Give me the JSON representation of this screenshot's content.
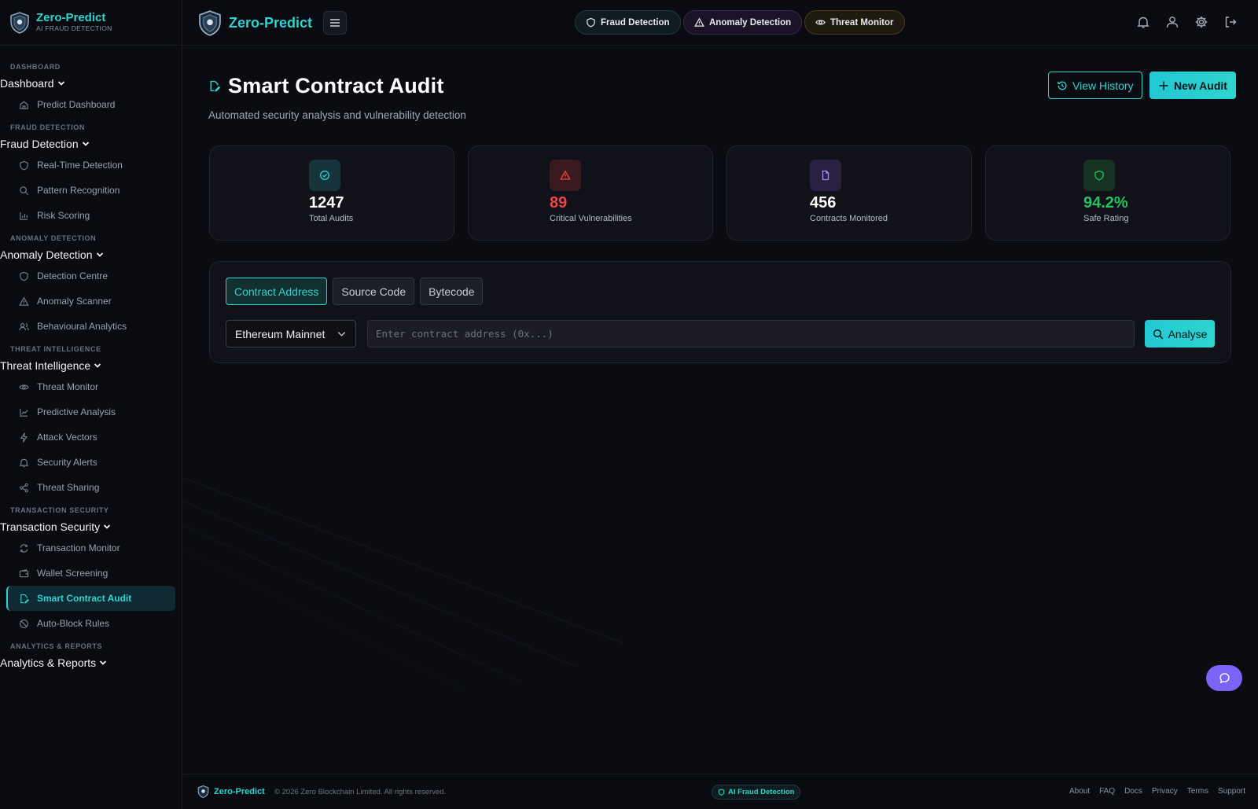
{
  "brand": {
    "name": "Zero-Predict",
    "tagline": "AI FRAUD DETECTION"
  },
  "sidebar": {
    "sections": [
      {
        "label": "DASHBOARD",
        "group": "Dashboard",
        "items": [
          {
            "label": "Predict Dashboard",
            "icon": "home-icon"
          }
        ]
      },
      {
        "label": "FRAUD DETECTION",
        "group": "Fraud Detection",
        "items": [
          {
            "label": "Real-Time Detection",
            "icon": "shield-icon"
          },
          {
            "label": "Pattern Recognition",
            "icon": "search-icon"
          },
          {
            "label": "Risk Scoring",
            "icon": "bar-chart-icon"
          }
        ]
      },
      {
        "label": "ANOMALY DETECTION",
        "group": "Anomaly Detection",
        "items": [
          {
            "label": "Detection Centre",
            "icon": "shield-icon"
          },
          {
            "label": "Anomaly Scanner",
            "icon": "warning-icon"
          },
          {
            "label": "Behavioural Analytics",
            "icon": "users-icon"
          }
        ]
      },
      {
        "label": "THREAT INTELLIGENCE",
        "group": "Threat Intelligence",
        "items": [
          {
            "label": "Threat Monitor",
            "icon": "eye-icon"
          },
          {
            "label": "Predictive Analysis",
            "icon": "line-chart-icon"
          },
          {
            "label": "Attack Vectors",
            "icon": "lightning-icon"
          },
          {
            "label": "Security Alerts",
            "icon": "bell-icon"
          },
          {
            "label": "Threat Sharing",
            "icon": "share-icon"
          }
        ]
      },
      {
        "label": "TRANSACTION SECURITY",
        "group": "Transaction Security",
        "items": [
          {
            "label": "Transaction Monitor",
            "icon": "refresh-icon"
          },
          {
            "label": "Wallet Screening",
            "icon": "wallet-icon"
          },
          {
            "label": "Smart Contract Audit",
            "icon": "edit-document-icon",
            "active": true
          },
          {
            "label": "Auto-Block Rules",
            "icon": "ban-icon"
          }
        ]
      },
      {
        "label": "ANALYTICS & REPORTS",
        "group": "Analytics & Reports",
        "items": []
      }
    ]
  },
  "topbar": {
    "pills": [
      {
        "label": "Fraud Detection",
        "icon": "shield-icon"
      },
      {
        "label": "Anomaly Detection",
        "icon": "warning-icon"
      },
      {
        "label": "Threat Monitor",
        "icon": "eye-icon"
      }
    ],
    "icons": [
      "bell-icon",
      "user-icon",
      "gear-icon",
      "logout-icon"
    ]
  },
  "page": {
    "title": "Smart Contract Audit",
    "subtitle": "Automated security analysis and vulnerability detection",
    "view_history_label": "View History",
    "new_audit_label": "New Audit"
  },
  "stats": [
    {
      "value": "1247",
      "label": "Total Audits",
      "icon": "check-circle-icon",
      "color": "#2dd4cf",
      "value_color": "#ffffff",
      "icon_bg": "#16343a"
    },
    {
      "value": "89",
      "label": "Critical Vulnerabilities",
      "icon": "warning-icon",
      "color": "#ef4444",
      "value_color": "#ef4444",
      "icon_bg": "#3a1a1e"
    },
    {
      "value": "456",
      "label": "Contracts Monitored",
      "icon": "document-icon",
      "color": "#a78bfa",
      "value_color": "#ffffff",
      "icon_bg": "#2a2142"
    },
    {
      "value": "94.2%",
      "label": "Safe Rating",
      "icon": "shield-icon",
      "color": "#22c55e",
      "value_color": "#22c55e",
      "icon_bg": "#163322"
    }
  ],
  "audit": {
    "tabs": [
      {
        "label": "Contract Address",
        "active": true
      },
      {
        "label": "Source Code",
        "active": false
      },
      {
        "label": "Bytecode",
        "active": false
      }
    ],
    "network": "Ethereum Mainnet",
    "address_placeholder": "Enter contract address (0x...)",
    "address_value": "",
    "analyse_label": "Analyse"
  },
  "footer": {
    "brand": "Zero-Predict",
    "copyright": "© 2026 Zero Blockchain Limited. All rights reserved.",
    "badge": "AI Fraud Detection",
    "links": [
      "About",
      "FAQ",
      "Docs",
      "Privacy",
      "Terms",
      "Support"
    ]
  },
  "colors": {
    "accent": "#2dd4cf",
    "background": "#0b0c12",
    "danger": "#ef4444",
    "success": "#22c55e",
    "purple": "#7b63f5"
  }
}
